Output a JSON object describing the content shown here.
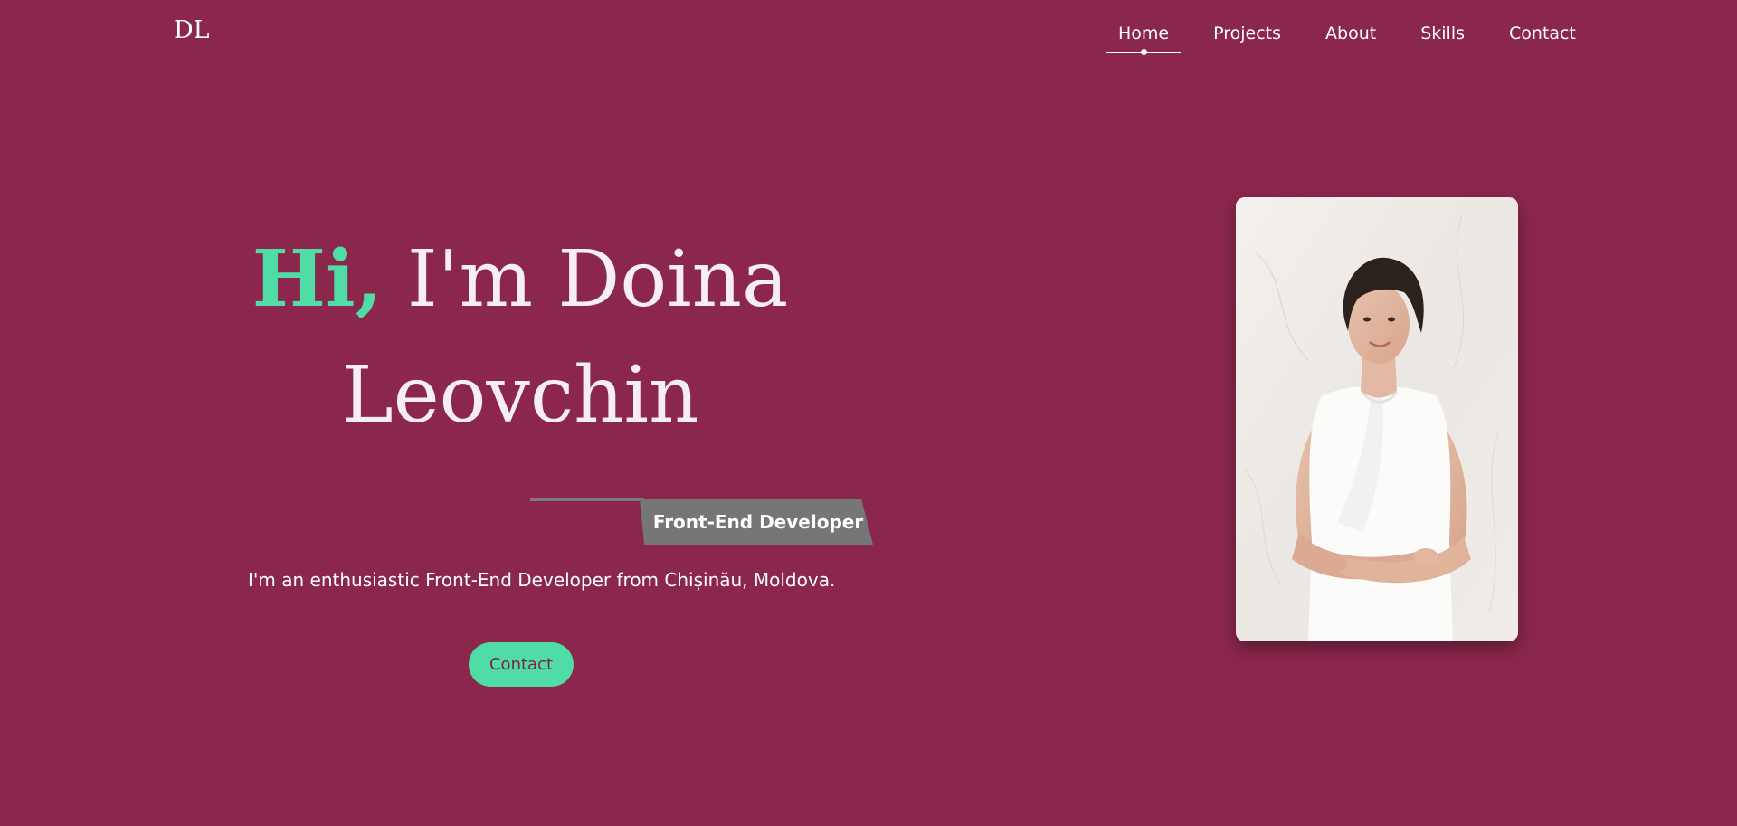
{
  "header": {
    "logo": "DL",
    "nav": [
      {
        "label": "Home",
        "active": true
      },
      {
        "label": "Projects",
        "active": false
      },
      {
        "label": "About",
        "active": false
      },
      {
        "label": "Skills",
        "active": false
      },
      {
        "label": "Contact",
        "active": false
      }
    ]
  },
  "hero": {
    "greeting": "Hi,",
    "name_line1": " I'm Doina",
    "name_line2": "Leovchin",
    "role": "Front-End Developer",
    "intro": "I'm an enthusiastic Front-End Developer from Chișinău, Moldova.",
    "contact_button": "Contact"
  },
  "colors": {
    "background": "#8b274c",
    "accent": "#4fdca7",
    "badge": "#767676",
    "text": "#ffffff"
  }
}
